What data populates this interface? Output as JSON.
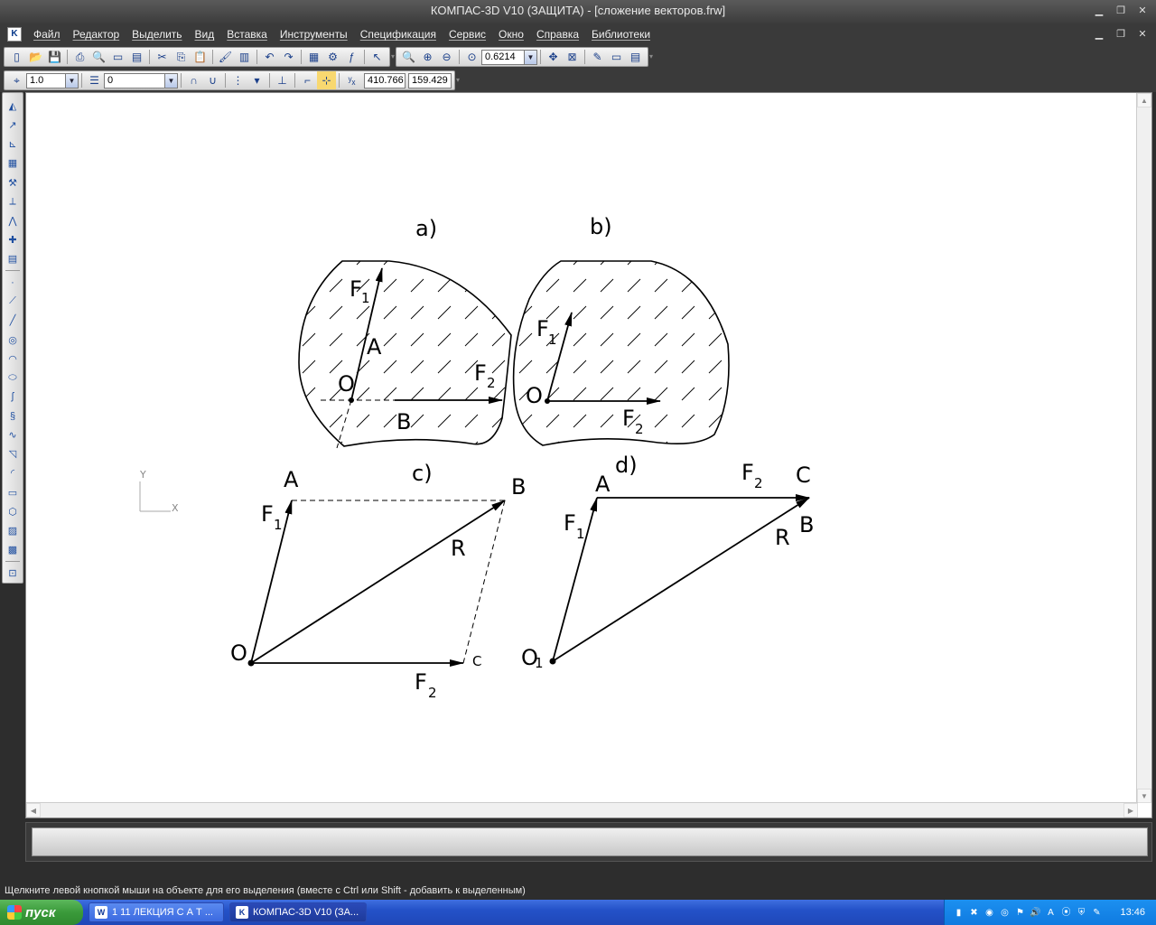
{
  "window": {
    "title": "КОМПАС-3D V10 (ЗАЩИТА) - [сложение векторов.frw]"
  },
  "menu": {
    "items": [
      "Файл",
      "Редактор",
      "Выделить",
      "Вид",
      "Вставка",
      "Инструменты",
      "Спецификация",
      "Сервис",
      "Окно",
      "Справка",
      "Библиотеки"
    ]
  },
  "toolbar": {
    "zoom_value": "0.6214",
    "scale_value": "1.0",
    "layer_value": "0",
    "coord_x": "410.766",
    "coord_y": "159.429"
  },
  "drawing": {
    "axis_y": "Y",
    "axis_x": "X",
    "fig_a_label": "a)",
    "fig_b_label": "b)",
    "fig_c_label": "c)",
    "fig_d_label": "d)",
    "a_F": "F",
    "a_F1_sub": "1",
    "a_A": "A",
    "a_O": "O",
    "a_B": "B",
    "a_F2": "F",
    "a_F2_sub": "2",
    "b_F1": "F",
    "b_F1_sub": "1",
    "b_O": "O",
    "b_F2": "F",
    "b_F2_sub": "2",
    "c_A": "A",
    "c_B": "B",
    "c_F1": "F",
    "c_F1_sub": "1",
    "c_R": "R",
    "c_O": "O",
    "c_C": "C",
    "c_F2": "F",
    "c_F2_sub": "2",
    "d_A": "A",
    "d_F2": "F",
    "d_F2_sub": "2",
    "d_C": "C",
    "d_B": "B",
    "d_F1": "F",
    "d_F1_sub": "1",
    "d_R": "R",
    "d_O": "O",
    "d_O_sub": "1"
  },
  "status": {
    "text": "Щелкните левой кнопкой мыши на объекте для его выделения (вместе с Ctrl или Shift - добавить к выделенным)"
  },
  "taskbar": {
    "start_label": "пуск",
    "tasks": [
      "1 11 ЛЕКЦИЯ С А Т ...",
      "КОМПАС-3D V10 (ЗА..."
    ],
    "clock": "13:46"
  },
  "colors": {
    "titlebar": "#4a4a4a",
    "taskbar": "#2452c8",
    "start": "#3a9a3a",
    "tray": "#0f7ae0"
  }
}
